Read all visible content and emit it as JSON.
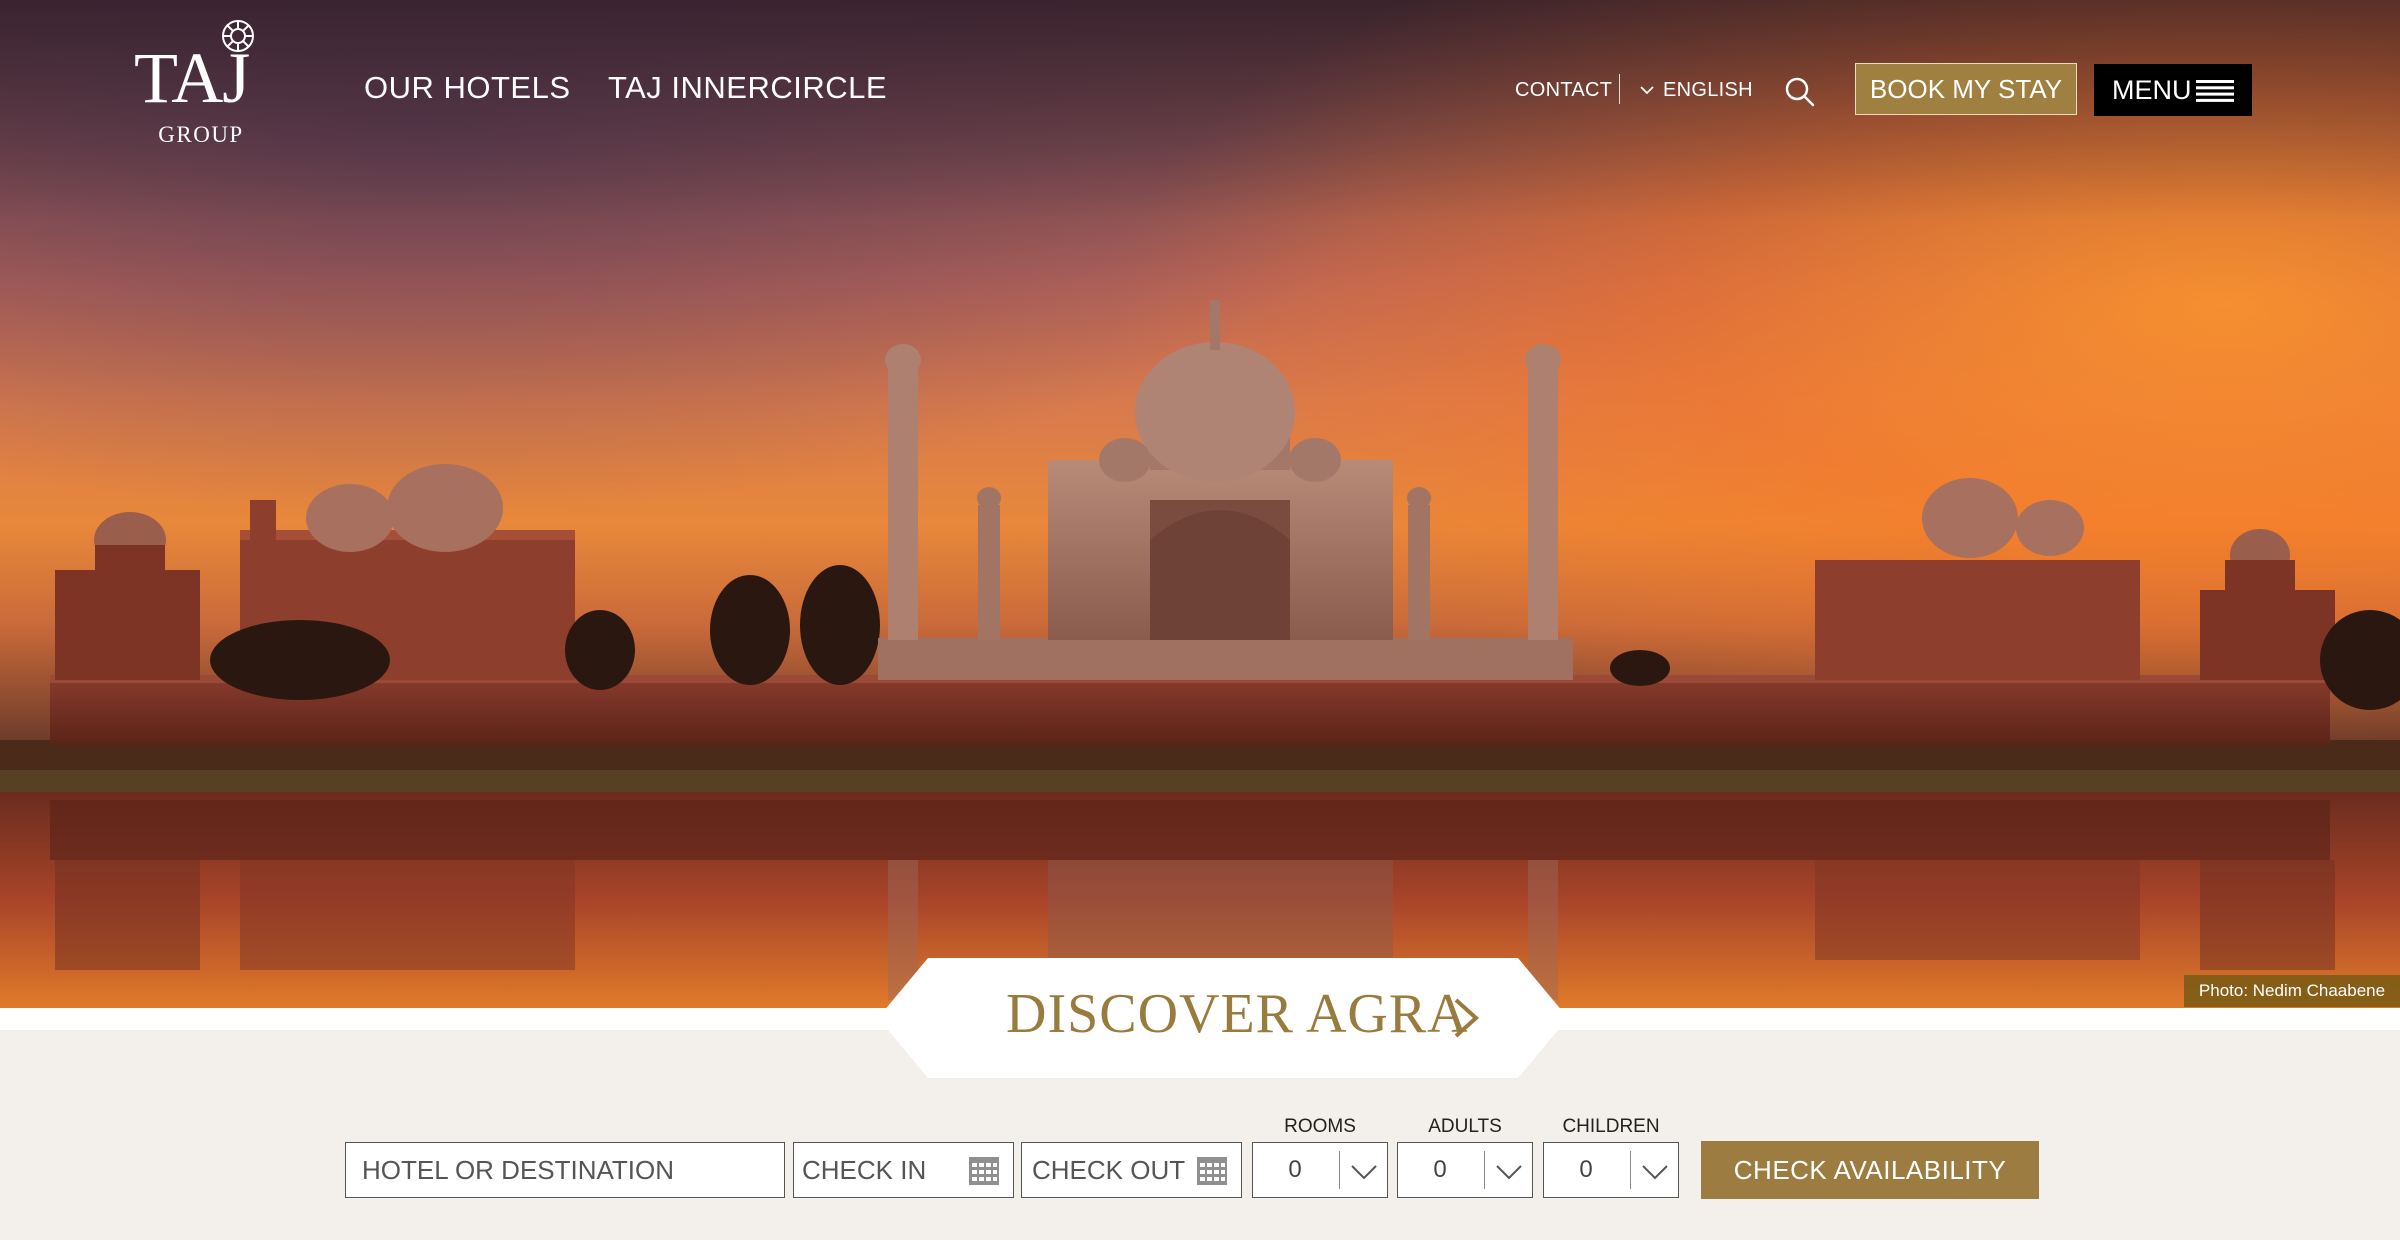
{
  "brand": {
    "logo_main": "TAJ",
    "logo_sub": "GROUP"
  },
  "nav": {
    "our_hotels": "OUR HOTELS",
    "innercircle": "TAJ INNERCIRCLE"
  },
  "utility": {
    "contact": "CONTACT",
    "language": "ENGLISH",
    "book_label": "BOOK MY STAY",
    "menu_label": "MENU"
  },
  "icons": {
    "search": "search-icon",
    "language_chevron": "chevron-down-icon",
    "menu": "hamburger-icon",
    "calendar": "calendar-icon",
    "discover_chevron": "chevron-right-icon",
    "logo_mark": "taj-emblem-icon"
  },
  "hero": {
    "photo_credit": "Photo: Nedim Chaabene",
    "discover_label": "DISCOVER AGRA"
  },
  "booking": {
    "destination_placeholder": "HOTEL OR DESTINATION",
    "check_in_placeholder": "CHECK IN",
    "check_out_placeholder": "CHECK OUT",
    "rooms": {
      "label": "ROOMS",
      "value": "0"
    },
    "adults": {
      "label": "ADULTS",
      "value": "0"
    },
    "children": {
      "label": "CHILDREN",
      "value": "0"
    },
    "submit_label": "CHECK AVAILABILITY"
  },
  "colors": {
    "gold": "#9c7c40",
    "gold_text": "#9a7b3e",
    "panel": "#f3f0ec",
    "menu_bg": "#000000"
  }
}
